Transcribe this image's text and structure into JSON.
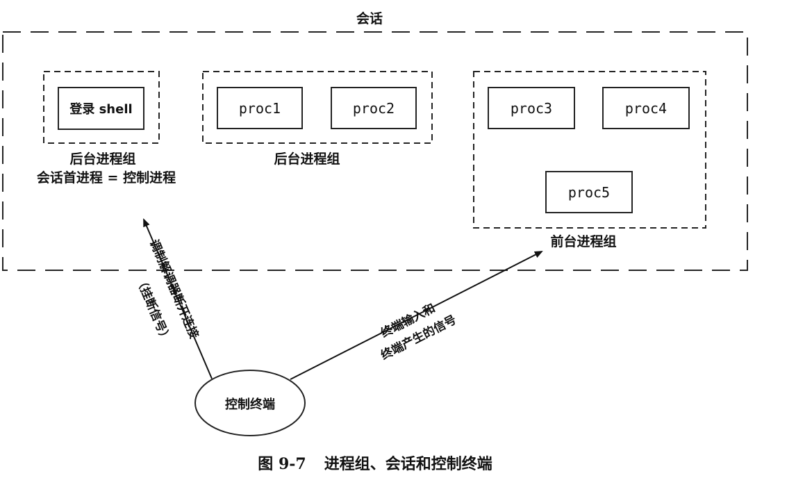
{
  "session": {
    "label": "会话"
  },
  "groups": {
    "login_group": {
      "label": "后台进程组",
      "sublabel": "会话首进程 = 控制进程",
      "process": "登录 shell"
    },
    "bg_group": {
      "label": "后台进程组",
      "processes": [
        "proc1",
        "proc2"
      ]
    },
    "fg_group": {
      "label": "前台进程组",
      "processes": [
        "proc3",
        "proc4",
        "proc5"
      ]
    }
  },
  "terminal": {
    "label": "控制终端"
  },
  "arrows": {
    "hangup": {
      "line1": "调制解调器断开连接",
      "line2": "（挂断信号）"
    },
    "input": {
      "line1": "终端输入和",
      "line2": "终端产生的信号"
    }
  },
  "caption": {
    "label": "图 9-7",
    "text": "进程组、会话和控制终端"
  }
}
